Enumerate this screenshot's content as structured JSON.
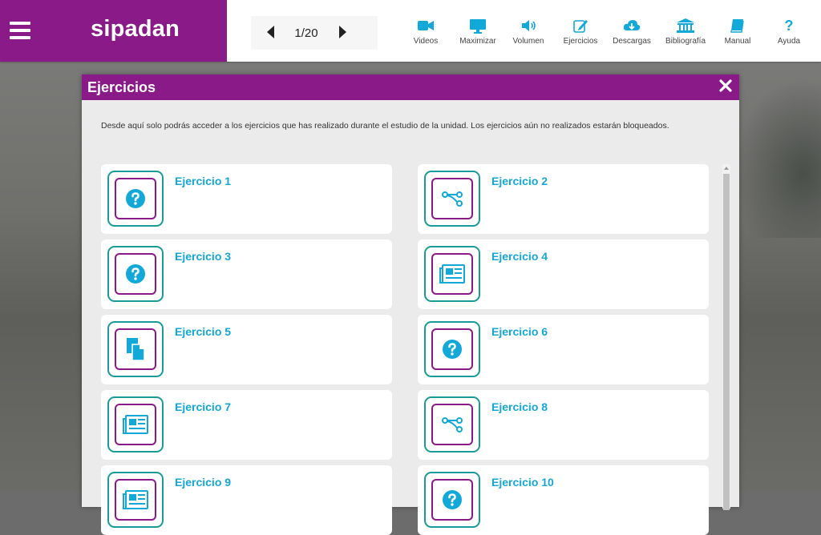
{
  "brand": {
    "logo": "sipadan"
  },
  "pager": {
    "label": "1/20"
  },
  "toolbar": [
    {
      "label": "Videos",
      "icon": "video-camera-icon"
    },
    {
      "label": "Maximizar",
      "icon": "monitor-icon"
    },
    {
      "label": "Volumen",
      "icon": "volume-icon"
    },
    {
      "label": "Ejercicios",
      "icon": "edit-icon"
    },
    {
      "label": "Descargas",
      "icon": "cloud-download-icon"
    },
    {
      "label": "Bibliografía",
      "icon": "library-icon"
    },
    {
      "label": "Manual",
      "icon": "book-icon"
    },
    {
      "label": "Ayuda",
      "icon": "question-icon"
    }
  ],
  "modal": {
    "title": "Ejercicios",
    "intro": "Desde aquí solo podrás acceder a los ejercicios que has realizado durante el estudio de la unidad. Los ejercicios aún no realizados estarán bloqueados.",
    "exercises": [
      {
        "title": "Ejercicio 1",
        "icon": "question-icon"
      },
      {
        "title": "Ejercicio 2",
        "icon": "connect-icon"
      },
      {
        "title": "Ejercicio 3",
        "icon": "question-icon"
      },
      {
        "title": "Ejercicio 4",
        "icon": "newspaper-icon"
      },
      {
        "title": "Ejercicio 5",
        "icon": "copy-icon"
      },
      {
        "title": "Ejercicio 6",
        "icon": "question-icon"
      },
      {
        "title": "Ejercicio 7",
        "icon": "newspaper-icon"
      },
      {
        "title": "Ejercicio 8",
        "icon": "connect-icon"
      },
      {
        "title": "Ejercicio 9",
        "icon": "newspaper-icon"
      },
      {
        "title": "Ejercicio 10",
        "icon": "question-icon"
      }
    ]
  },
  "colors": {
    "brand": "#8a1a87",
    "accent": "#14a7d6",
    "tile_border": "#1a9a98"
  }
}
